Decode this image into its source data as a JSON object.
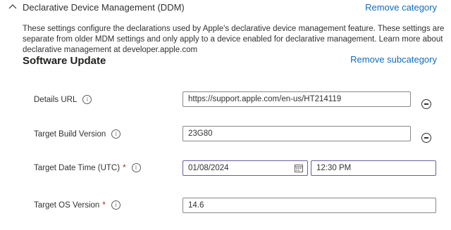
{
  "category": {
    "title": "Declarative Device Management (DDM)",
    "remove_label": "Remove category",
    "description": "These settings configure the declarations used by Apple's declarative device management feature. These settings are separate from older MDM settings and only apply to a device enabled for declarative management. Learn more about declarative management at developer.apple.com"
  },
  "subcategory": {
    "title": "Software Update",
    "remove_label": "Remove subcategory"
  },
  "fields": {
    "details_url": {
      "label": "Details URL",
      "value": "https://support.apple.com/en-us/HT214119"
    },
    "target_build_version": {
      "label": "Target Build Version",
      "value": "23G80"
    },
    "target_date_time": {
      "label": "Target Date Time (UTC)",
      "required_marker": "*",
      "date_value": "01/08/2024",
      "time_value": "12:30 PM"
    },
    "target_os_version": {
      "label": "Target OS Version",
      "required_marker": "*",
      "value": "14.6"
    }
  },
  "info_glyph": "i",
  "colors": {
    "link": "#0f6cbd",
    "required": "#a4262c",
    "active_border": "#6b5aa6"
  },
  "icons": [
    "chevron-up-icon",
    "info-icon",
    "remove-circle-icon",
    "calendar-icon"
  ]
}
